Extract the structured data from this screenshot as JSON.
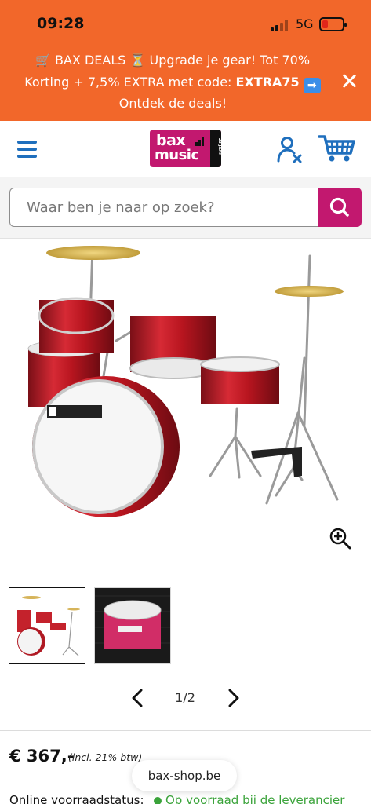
{
  "status_bar": {
    "time": "09:28",
    "network": "5G"
  },
  "promo": {
    "line1": "🛒 BAX DEALS ⏳ Upgrade je gear! Tot 70%",
    "line2_prefix": "Korting + 7,5% EXTRA met code: ",
    "line2_code": "EXTRA75",
    "line2_arrow": "➡",
    "line3": "Ontdek de deals!"
  },
  "header": {
    "logo_top": "bax",
    "logo_bottom": "music",
    "logo_tag": "23 JAAR",
    "brand_color": "#c2186f",
    "promo_color": "#f2672a",
    "icon_color": "#1f6fbd"
  },
  "search": {
    "placeholder": "Waar ben je naar op zoek?"
  },
  "gallery": {
    "pager": "1/2"
  },
  "product": {
    "price": "€ 367,-",
    "price_note": "(incl. 21% btw)",
    "stock_label": "Online voorraadstatus:",
    "stock_value": "Op voorraad bij de leverancier",
    "stock_color": "#3aa33a"
  },
  "browser": {
    "url": "bax-shop.be"
  }
}
